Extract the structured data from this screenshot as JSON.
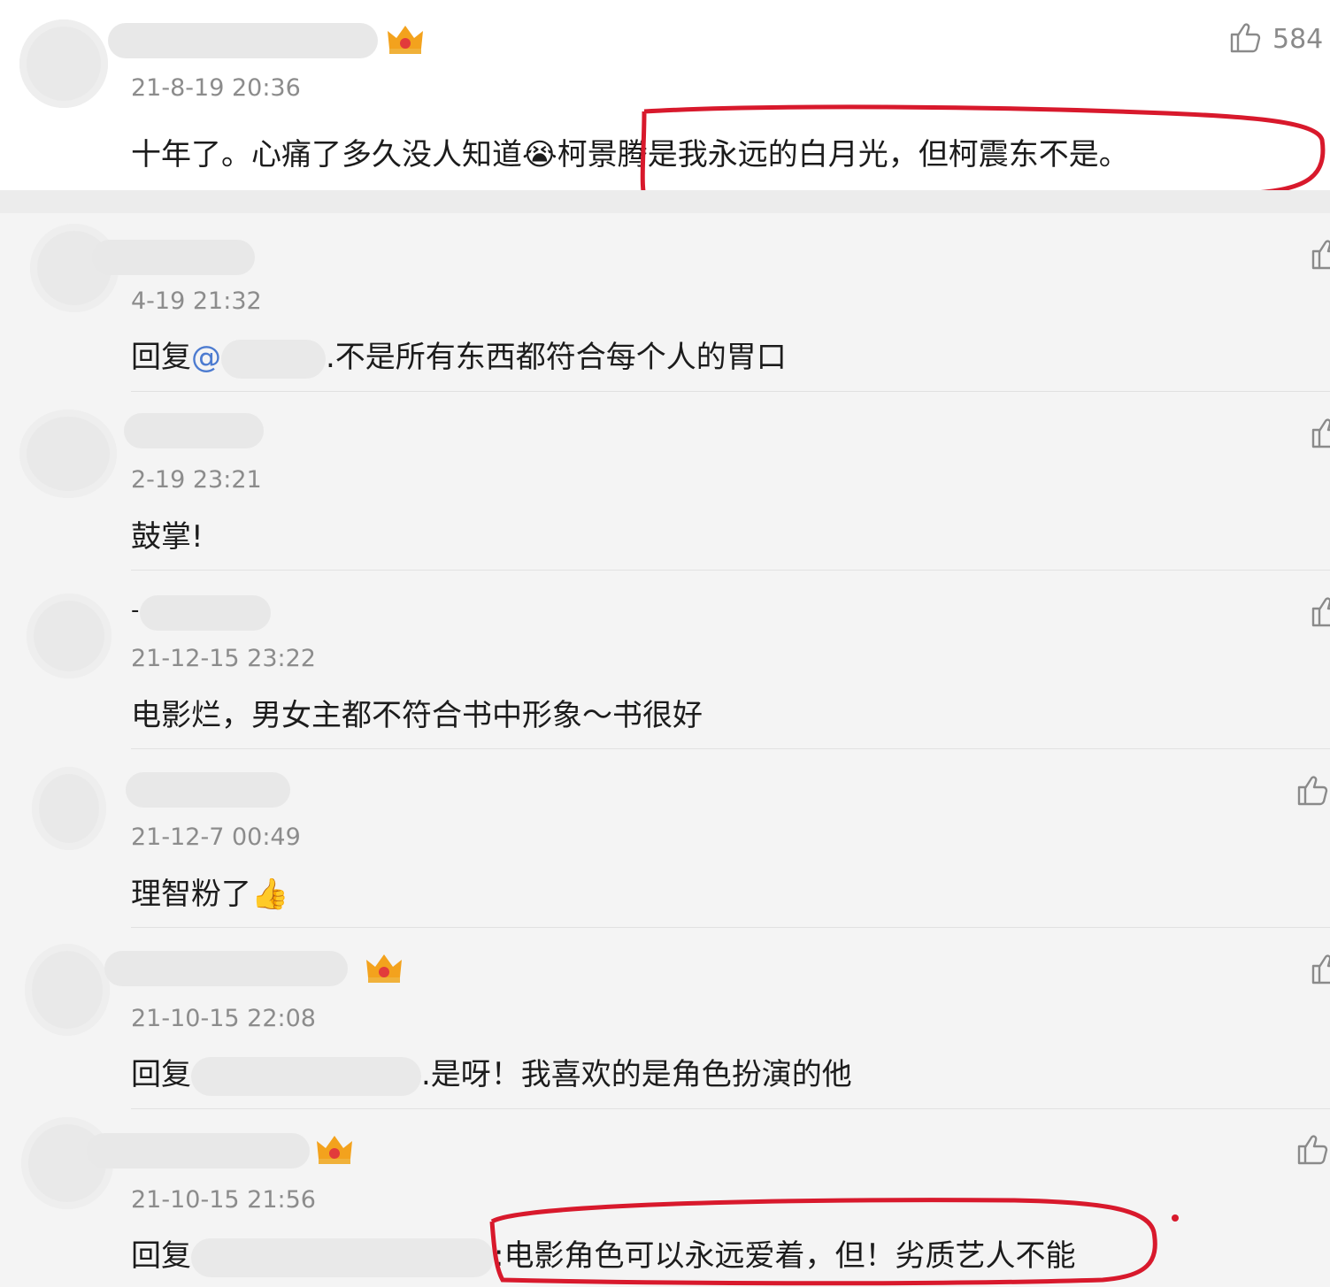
{
  "main": {
    "time": "21-8-19 20:36",
    "likes": "584",
    "text_a": "十年了。心痛了多久没人知道",
    "emoji": "😭",
    "text_b": "柯景腾是我永远的白月光，但柯震东不是。",
    "badge_level": "6"
  },
  "replies": [
    {
      "time": "4-19 21:32",
      "prefix": "回复",
      "mention": "@",
      "text": ".不是所有东西都符合每个人的胃口"
    },
    {
      "time": "2-19 23:21",
      "text": "鼓掌!"
    },
    {
      "time": "21-12-15 23:22",
      "name_char": "-",
      "text": "电影烂，男女主都不符合书中形象～书很好"
    },
    {
      "time": "21-12-7 00:49",
      "text": "理智粉了",
      "emoji": "👍"
    },
    {
      "time": "21-10-15 22:08",
      "prefix": "回复",
      "text": ".是呀！我喜欢的是角色扮演的他",
      "badge_level": "6"
    },
    {
      "time": "21-10-15 21:56",
      "prefix": "回复",
      "text": ":电影角色可以永远爱着，但！劣质艺人不能",
      "badge_level": "4"
    }
  ],
  "colors": {
    "mention": "#4c7bd0",
    "annotation": "#d8192c",
    "crown": "#f3a21d"
  }
}
